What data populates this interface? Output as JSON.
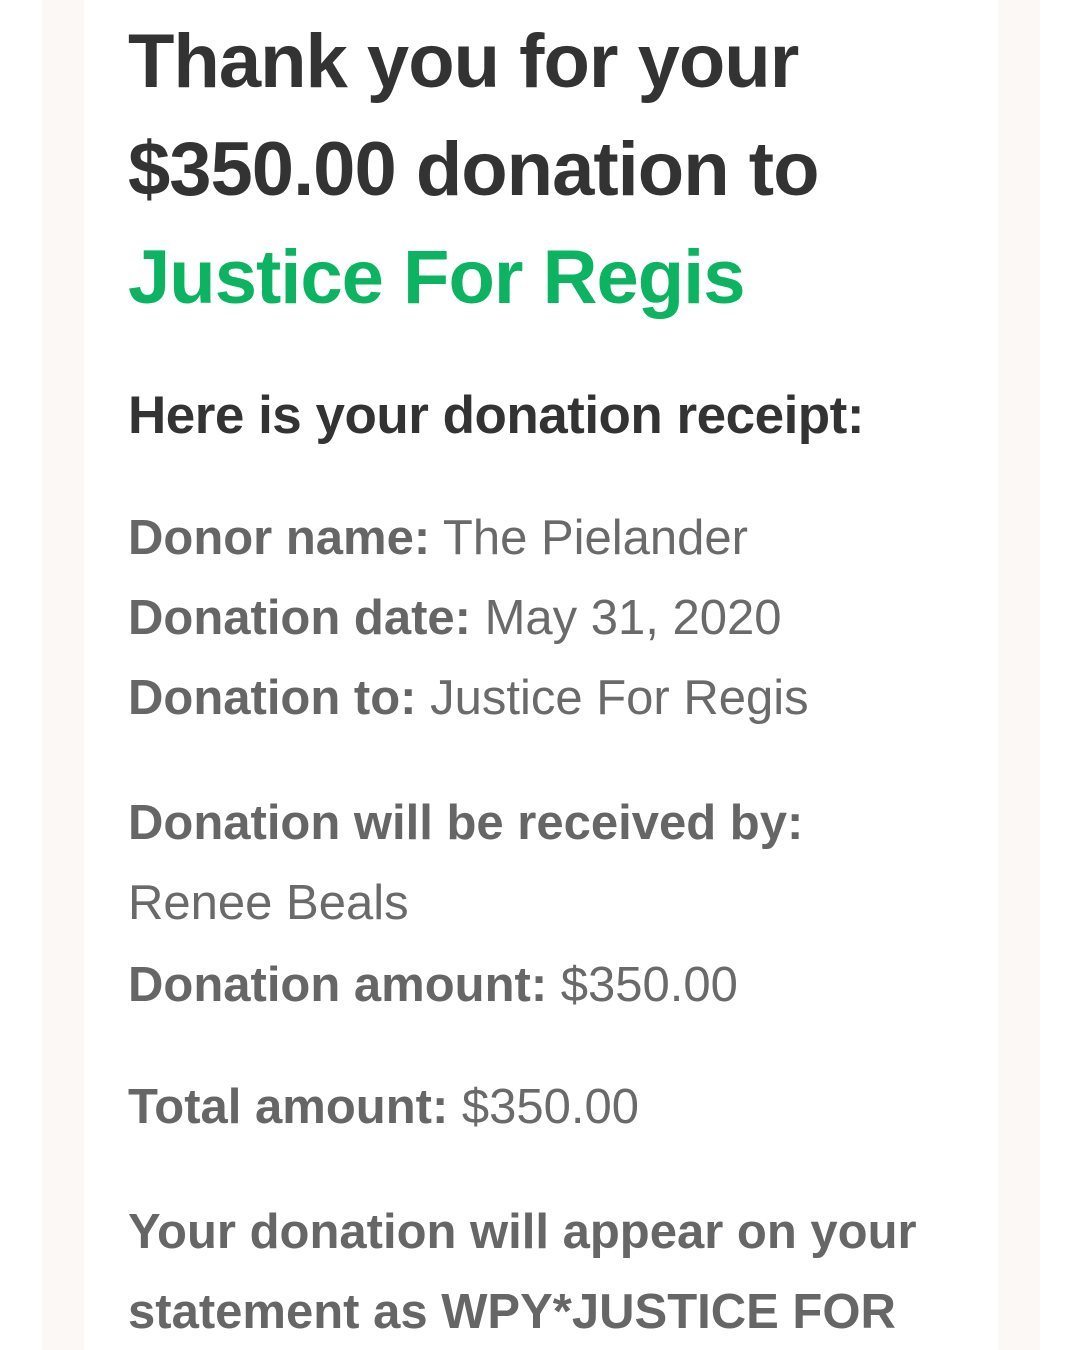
{
  "headline": {
    "line1": "Thank you for your",
    "line2": "$350.00 donation to",
    "campaign": "Justice For Regis"
  },
  "receipt_heading": "Here is your donation receipt:",
  "receipt": {
    "donor_name_label": "Donor name:",
    "donor_name": "The Pielander",
    "donation_date_label": "Donation date:",
    "donation_date": "May 31, 2020",
    "donation_to_label": "Donation to:",
    "donation_to": "Justice For Regis",
    "received_by_label": "Donation will be received by:",
    "received_by": "Renee Beals",
    "amount_label": "Donation amount:",
    "amount": "$350.00",
    "total_label": "Total amount:",
    "total": "$350.00"
  },
  "statement_text": "Your donation will appear on your statement as WPY*JUSTICE FOR",
  "colors": {
    "accent_green": "#0cb462",
    "heading_text": "#333333",
    "body_text": "#666666"
  }
}
